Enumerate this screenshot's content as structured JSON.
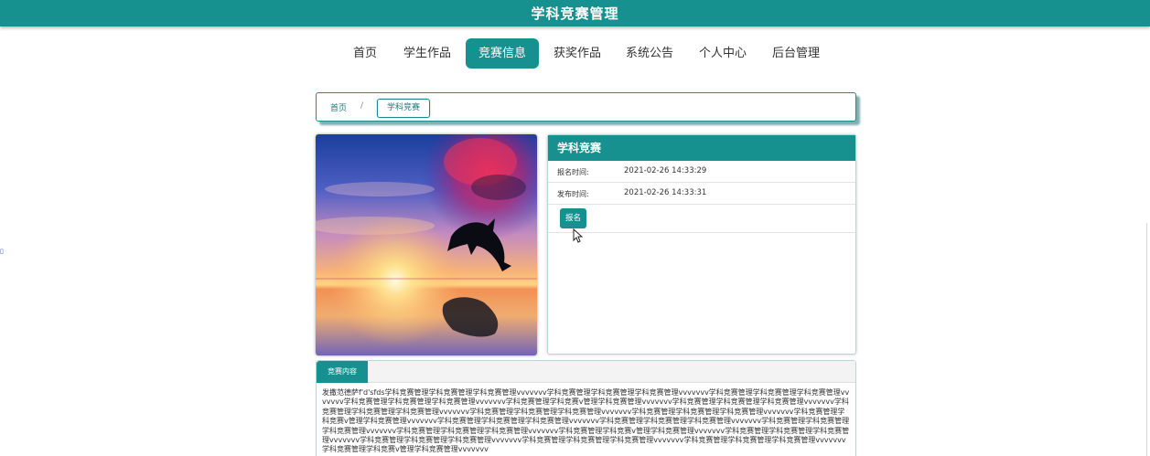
{
  "header": {
    "title": "学科竞赛管理"
  },
  "nav": {
    "items": [
      {
        "label": "首页"
      },
      {
        "label": "学生作品"
      },
      {
        "label": "竞赛信息"
      },
      {
        "label": "获奖作品"
      },
      {
        "label": "系统公告"
      },
      {
        "label": "个人中心"
      },
      {
        "label": "后台管理"
      }
    ]
  },
  "breadcrumb": {
    "home": "首页",
    "separator": "/",
    "current": "学科竞赛"
  },
  "detail": {
    "title": "学科竞赛",
    "signup_time_label": "报名时间:",
    "signup_time": "2021-02-26 14:33:29",
    "publish_time_label": "发布时间:",
    "publish_time": "2021-02-26 14:33:31",
    "signup_button": "报名"
  },
  "content": {
    "tab_label": "竞赛内容",
    "text": "发撒范德萨f'd'sfds学科竞赛管理学科竞赛管理学科竞赛管理vvvvvvv学科竞赛管理学科竞赛管理学科竞赛管理vvvvvvv学科竞赛管理学科竞赛管理学科竞赛管理vvvvvvv学科竞赛管理学科竞赛管理学科竞赛管理vvvvvvv学科竞赛管理学科竞赛v管理学科竞赛管理vvvvvvv学科竞赛管理学科竞赛管理学科竞赛管理vvvvvvv学科竞赛管理学科竞赛管理学科竞赛管理vvvvvvv学科竞赛管理学科竞赛管理学科竞赛管理vvvvvvv学科竞赛管理学科竞赛管理学科竞赛管理vvvvvvv学科竞赛管理学科竞赛v管理学科竞赛管理vvvvvvv学科竞赛管理学科竞赛管理学科竞赛管理vvvvvvv学科竞赛管理学科竞赛管理学科竞赛管理vvvvvvv学科竞赛管理学科竞赛管理学科竞赛管理vvvvvvv学科竞赛管理学科竞赛管理学科竞赛管理vvvvvvv学科竞赛管理学科竞赛v管理学科竞赛管理vvvvvvv学科竞赛管理学科竞赛管理学科竞赛管理vvvvvvv学科竞赛管理学科竞赛管理学科竞赛管理vvvvvvv学科竞赛管理学科竞赛管理学科竞赛管理vvvvvvv学科竞赛管理学科竞赛管理学科竞赛管理vvvvvvv学科竞赛管理学科竞赛v管理学科竞赛管理vvvvvvv"
  },
  "colors": {
    "accent": "#16918f",
    "accent_dark": "#1a7a78",
    "border": "#b8d6d5"
  }
}
